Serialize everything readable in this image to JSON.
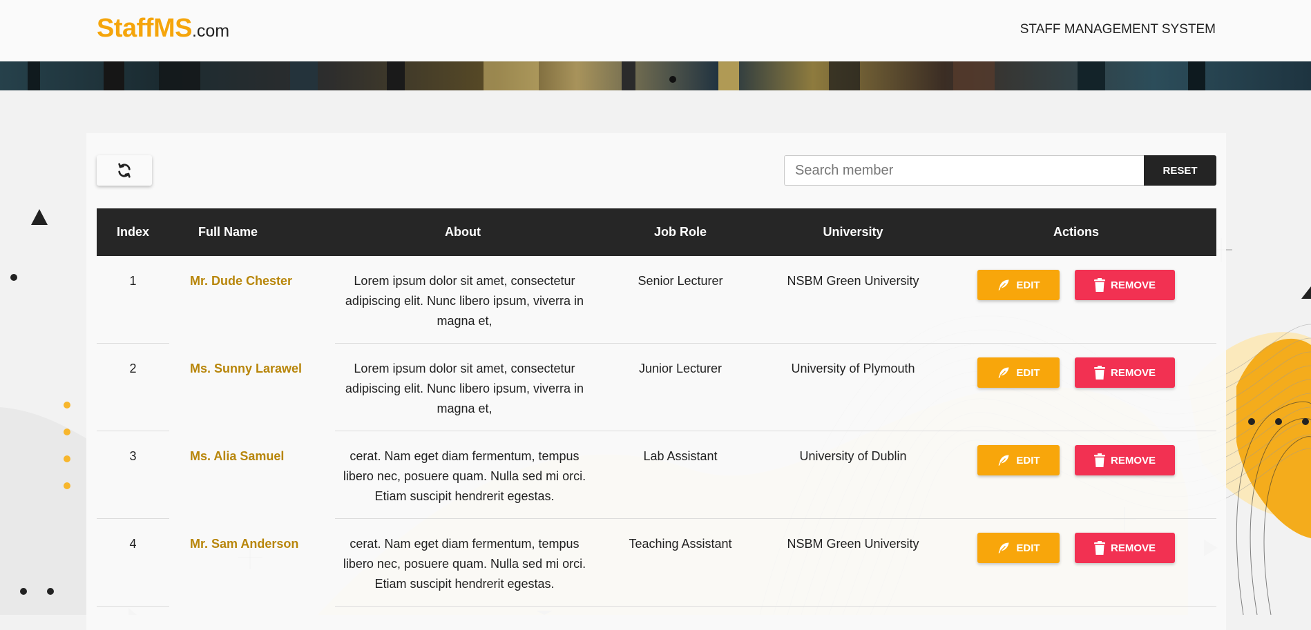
{
  "header": {
    "brand_main": "StaffMS",
    "brand_suffix": ".com",
    "title": "STAFF MANAGEMENT SYSTEM"
  },
  "toolbar": {
    "refresh_icon": "refresh-icon",
    "search_placeholder": "Search member",
    "search_value": "",
    "reset_label": "RESET"
  },
  "table": {
    "columns": [
      "Index",
      "Full Name",
      "About",
      "Job Role",
      "University",
      "Actions"
    ],
    "rows": [
      {
        "index": "1",
        "name": "Mr. Dude Chester",
        "about": "Lorem ipsum dolor sit amet, consectetur adipiscing elit. Nunc libero ipsum, viverra in magna et,",
        "role": "Senior Lecturer",
        "university": "NSBM Green University",
        "edit": "EDIT",
        "remove": "REMOVE"
      },
      {
        "index": "2",
        "name": "Ms. Sunny Larawel",
        "about": "Lorem ipsum dolor sit amet, consectetur adipiscing elit. Nunc libero ipsum, viverra in magna et,",
        "role": "Junior Lecturer",
        "university": "University of Plymouth",
        "edit": "EDIT",
        "remove": "REMOVE"
      },
      {
        "index": "3",
        "name": "Ms. Alia Samuel",
        "about": "cerat. Nam eget diam fermentum, tempus libero nec, posuere quam. Nulla sed mi orci. Etiam suscipit hendrerit egestas.",
        "role": "Lab Assistant",
        "university": "University of Dublin",
        "edit": "EDIT",
        "remove": "REMOVE"
      },
      {
        "index": "4",
        "name": "Mr. Sam Anderson",
        "about": "cerat. Nam eget diam fermentum, tempus libero nec, posuere quam. Nulla sed mi orci. Etiam suscipit hendrerit egestas.",
        "role": "Teaching Assistant",
        "university": "NSBM Green University",
        "edit": "EDIT",
        "remove": "REMOVE"
      }
    ]
  },
  "icons": {
    "edit": "feather-icon",
    "remove": "trash-icon"
  },
  "colors": {
    "brand": "#f5a50b",
    "edit_button": "#f8a60b",
    "remove_button": "#f23152",
    "table_header": "#262626",
    "name_text": "#b8860b"
  }
}
